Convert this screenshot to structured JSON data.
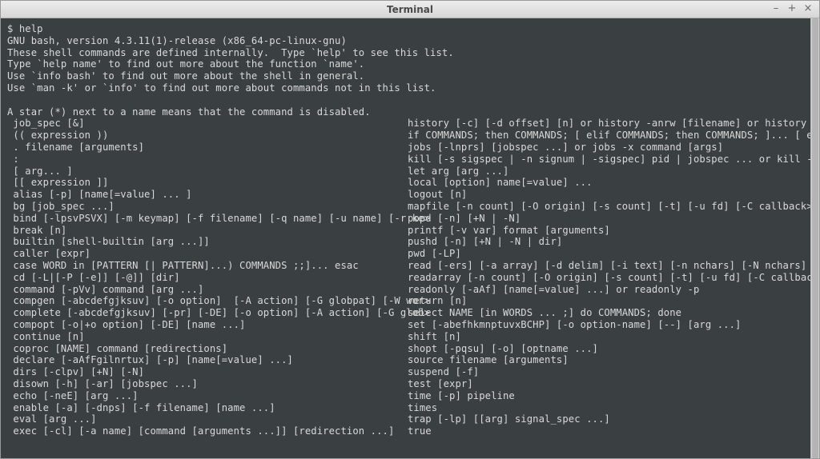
{
  "window": {
    "title": "Terminal",
    "buttons": {
      "min": "–",
      "max": "+",
      "close": "×"
    }
  },
  "prompt": "$ ",
  "command": "help",
  "intro": [
    "GNU bash, version 4.3.11(1)-release (x86_64-pc-linux-gnu)",
    "These shell commands are defined internally.  Type `help' to see this list.",
    "Type `help name' to find out more about the function `name'.",
    "Use `info bash' to find out more about the shell in general.",
    "Use `man -k' or `info' to find out more about commands not in this list.",
    "",
    "A star (*) next to a name means that the command is disabled.",
    ""
  ],
  "col1": [
    "job_spec [&]",
    "(( expression ))",
    ". filename [arguments]",
    ":",
    "[ arg... ]",
    "[[ expression ]]",
    "alias [-p] [name[=value] ... ]",
    "bg [job_spec ...]",
    "bind [-lpsvPSVX] [-m keymap] [-f filename] [-q name] [-u name] [-r ke>",
    "break [n]",
    "builtin [shell-builtin [arg ...]]",
    "caller [expr]",
    "case WORD in [PATTERN [| PATTERN]...) COMMANDS ;;]... esac",
    "cd [-L|[-P [-e]] [-@]] [dir]",
    "command [-pVv] command [arg ...]",
    "compgen [-abcdefgjksuv] [-o option]  [-A action] [-G globpat] [-W wor>",
    "complete [-abcdefgjksuv] [-pr] [-DE] [-o option] [-A action] [-G glob>",
    "compopt [-o|+o option] [-DE] [name ...]",
    "continue [n]",
    "coproc [NAME] command [redirections]",
    "declare [-aAfFgilnrtux] [-p] [name[=value] ...]",
    "dirs [-clpv] [+N] [-N]",
    "disown [-h] [-ar] [jobspec ...]",
    "echo [-neE] [arg ...]",
    "enable [-a] [-dnps] [-f filename] [name ...]",
    "eval [arg ...]",
    "exec [-cl] [-a name] [command [arguments ...]] [redirection ...]"
  ],
  "col2": [
    "history [-c] [-d offset] [n] or history -anrw [filename] or history >",
    "if COMMANDS; then COMMANDS; [ elif COMMANDS; then COMMANDS; ]... [ e>",
    "jobs [-lnprs] [jobspec ...] or jobs -x command [args]",
    "kill [-s sigspec | -n signum | -sigspec] pid | jobspec ... or kill ->",
    "let arg [arg ...]",
    "local [option] name[=value] ...",
    "logout [n]",
    "mapfile [-n count] [-O origin] [-s count] [-t] [-u fd] [-C callback>",
    "popd [-n] [+N | -N]",
    "printf [-v var] format [arguments]",
    "pushd [-n] [+N | -N | dir]",
    "pwd [-LP]",
    "read [-ers] [-a array] [-d delim] [-i text] [-n nchars] [-N nchars] >",
    "readarray [-n count] [-O origin] [-s count] [-t] [-u fd] [-C callbac>",
    "readonly [-aAf] [name[=value] ...] or readonly -p",
    "return [n]",
    "select NAME [in WORDS ... ;] do COMMANDS; done",
    "set [-abefhkmnptuvxBCHP] [-o option-name] [--] [arg ...]",
    "shift [n]",
    "shopt [-pqsu] [-o] [optname ...]",
    "source filename [arguments]",
    "suspend [-f]",
    "test [expr]",
    "time [-p] pipeline",
    "times",
    "trap [-lp] [[arg] signal_spec ...]",
    "true"
  ]
}
